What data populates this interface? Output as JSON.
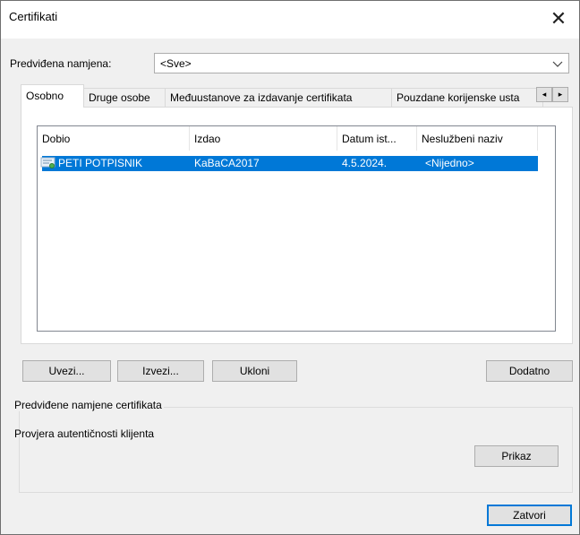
{
  "window": {
    "title": "Certifikati",
    "close_glyph": "✕"
  },
  "purpose": {
    "label": "Predviđena namjena:",
    "value": "<Sve>",
    "arrow_icon": "chevron-down-icon"
  },
  "tabs": [
    {
      "label": "Osobno",
      "active": true
    },
    {
      "label": "Druge osobe"
    },
    {
      "label": "Međuustanove za izdavanje certifikata"
    },
    {
      "label": "Pouzdane korijenske usta"
    }
  ],
  "tab_scroll": {
    "left": "◂",
    "right": "▸"
  },
  "list": {
    "columns": [
      "Dobio",
      "Izdao",
      "Datum ist...",
      "Neslužbeni naziv"
    ],
    "rows": [
      {
        "issued_to": "PETI POTPISNIK",
        "issued_by": "KaBaCA2017",
        "expiry": "4.5.2024.",
        "friendly_name": "<Nijedno>",
        "selected": true
      }
    ]
  },
  "buttons": {
    "import": "Uvezi...",
    "export": "Izvezi...",
    "remove": "Ukloni",
    "advanced": "Dodatno",
    "view": "Prikaz",
    "close": "Zatvori"
  },
  "purposes_group": {
    "title": "Predviđene namjene certifikata",
    "text": "Provjera autentičnosti klijenta"
  },
  "colors": {
    "selection": "#0078d7",
    "dialog_bg": "#f0f0f0"
  }
}
